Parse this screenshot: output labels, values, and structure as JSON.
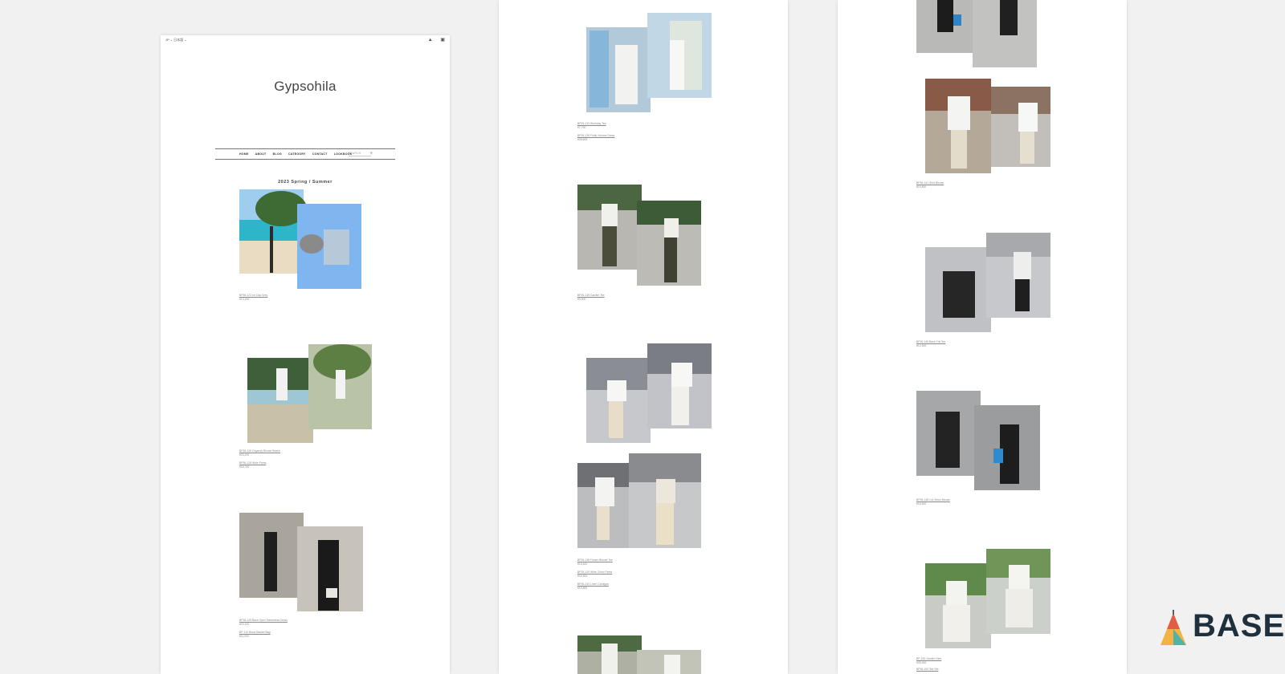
{
  "shop": {
    "logo": "Gypsohila",
    "season_heading": "2023 Spring / Summer",
    "topbar": {
      "lang": "JP ⌄   日本語 ⌄",
      "icons": [
        "user-icon",
        "cart-icon"
      ]
    },
    "nav": {
      "items": [
        "HOME",
        "ABOUT",
        "BLOG",
        "CATEGORY",
        "CONTACT",
        "LOOKBOOK"
      ],
      "search_placeholder": "SEARCH"
    }
  },
  "lookbook": [
    {
      "caption": "BP36-123 Int Cap Grey",
      "price": "¥13,200"
    },
    {
      "caption": "BP36-126 Organdy Blouse Beach",
      "price": "¥23,100",
      "caption2": "BP36-128 Wide Pants",
      "price2": "¥18,700"
    },
    {
      "caption": "BP36-129 Back Open Sleeveless Dress",
      "price": "¥24,200",
      "caption2": "BP-110 Black Basket Bag",
      "price2": "¥11,000"
    },
    {
      "caption": "BP26-133 Workday Tee",
      "price": "¥7,700",
      "caption2": "BP26-135 Fluffy Volume Dress",
      "price2": "¥28,600"
    },
    {
      "caption": "BP26-136 Garden Tee",
      "price": "¥9,900"
    },
    {
      "caption": "BP26-138 Flower Blouse Tee",
      "price": "¥15,400",
      "caption2": "BP26-139 Wide Chino Pants",
      "price2": "¥16,500",
      "caption3": "BP26-140 Linen Cardigan",
      "price3": "¥19,800"
    },
    {
      "caption": "BP36-141 Shirt Blouse",
      "price": "¥19,800"
    },
    {
      "caption": "BP26-145 Back Frill Tee",
      "price": "¥14,300"
    },
    {
      "caption": "BP26-148 Cut Sewn Blouse",
      "price": "¥16,500"
    },
    {
      "caption": "BP-150 Garden Skirt",
      "price": "¥25,300",
      "caption2": "BP36-152 Tee Set",
      "price2": ""
    }
  ],
  "colors": {
    "accent": "#1e2f3d",
    "badge_top": "#e25d45",
    "badge_left": "#f2b344",
    "badge_right": "#53b2a5"
  },
  "badge": {
    "text": "BASE"
  }
}
